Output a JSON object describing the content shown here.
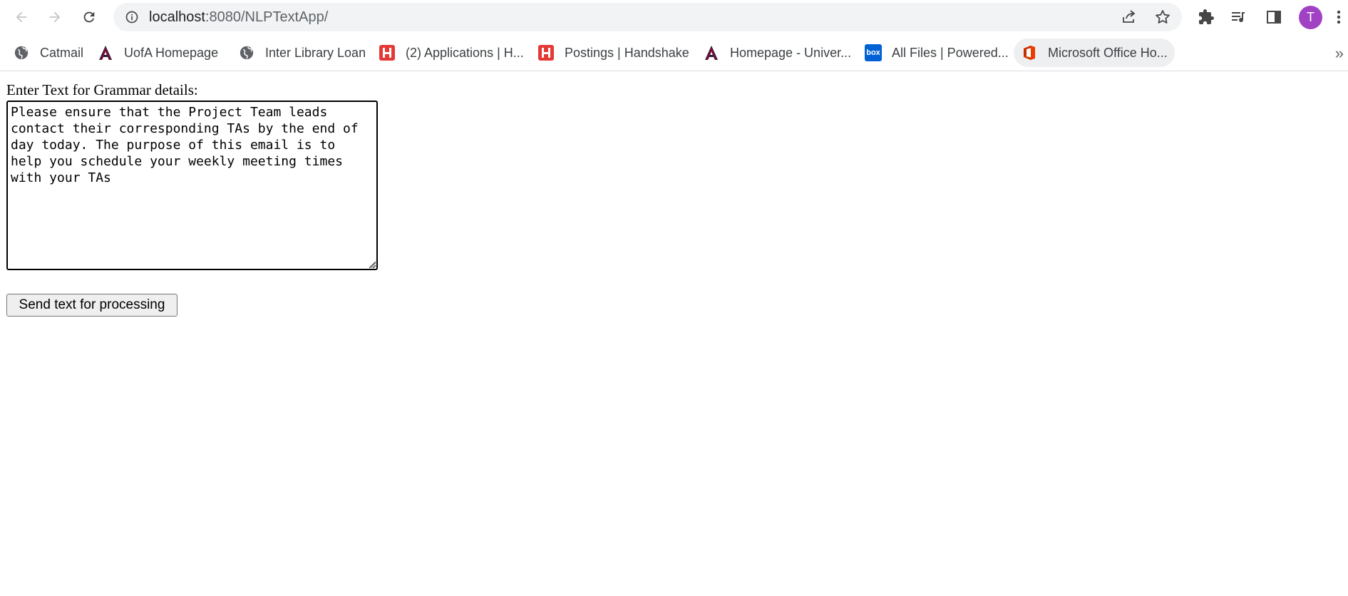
{
  "browser": {
    "url_host": "localhost",
    "url_rest": ":8080/NLPTextApp/",
    "profile_initial": "T",
    "colors": {
      "avatar": "#a142c4",
      "omnibox": "#f1f3f4",
      "handshake": "#e53935",
      "uofa": "#ab0520",
      "box": "#0061d5"
    },
    "icons": [
      "back-arrow-icon",
      "forward-arrow-icon",
      "reload-icon",
      "info-icon",
      "share-icon",
      "star-icon",
      "extensions-icon",
      "media-queue-icon",
      "side-panel-icon",
      "more-vert-icon"
    ]
  },
  "bookmarks": [
    {
      "label": "Catmail",
      "icon": "globe-icon"
    },
    {
      "label": "UofA Homepage",
      "icon": "uofa-logo-icon"
    },
    {
      "label": "Inter Library Loan",
      "icon": "globe-icon"
    },
    {
      "label": "(2) Applications | H...",
      "icon": "handshake-logo-icon"
    },
    {
      "label": "Postings | Handshake",
      "icon": "handshake-logo-icon"
    },
    {
      "label": "Homepage - Univer...",
      "icon": "uofa-logo-icon"
    },
    {
      "label": "All Files | Powered...",
      "icon": "box-logo-icon",
      "box_text": "box"
    },
    {
      "label": "Microsoft Office Ho...",
      "icon": "office-logo-icon"
    }
  ],
  "form": {
    "label": "Enter Text for Grammar details:",
    "textarea_value": "Please ensure that the Project Team leads contact their corresponding TAs by the end of day today. The purpose of this email is to help you schedule your weekly meeting times with your TAs",
    "submit_label": "Send text for processing"
  }
}
